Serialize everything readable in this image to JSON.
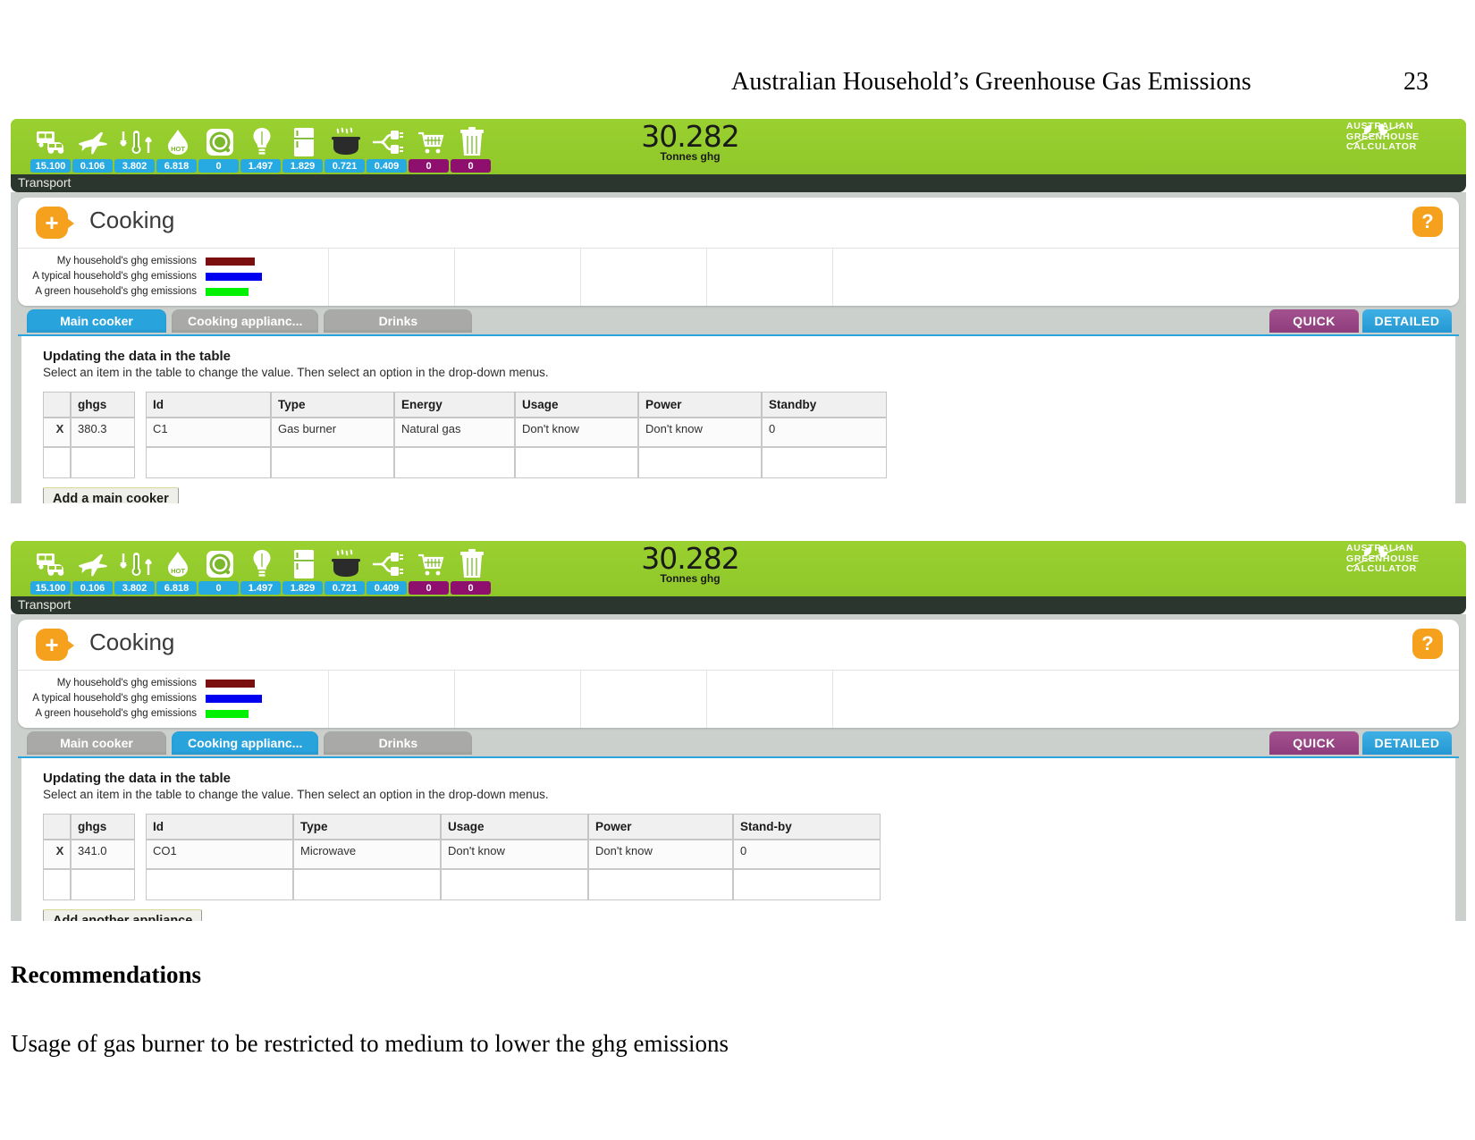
{
  "document": {
    "header_title": "Australian Household’s Greenhouse Gas Emissions",
    "page_number": "23",
    "recommendations_heading": "Recommendations",
    "recommendation_text": "Usage of gas burner to be restricted to medium to lower the ghg emissions"
  },
  "app": {
    "toolbar": {
      "total_value": "30.282",
      "total_unit": "Tonnes ghg",
      "logo_line1": "AUSTRALIAN",
      "logo_line2": "GREENHOUSE",
      "logo_line3": "CALCULATOR",
      "breadcrumb": "Transport",
      "icons": [
        {
          "name": "transport-icon",
          "value": "15.100",
          "color": "blue"
        },
        {
          "name": "flights-icon",
          "value": "0.106",
          "color": "blue"
        },
        {
          "name": "heating-cooling-icon",
          "value": "3.802",
          "color": "blue"
        },
        {
          "name": "hot-water-icon",
          "value": "6.818",
          "color": "blue"
        },
        {
          "name": "washing-icon",
          "value": "0",
          "color": "blue"
        },
        {
          "name": "lighting-icon",
          "value": "1.497",
          "color": "blue"
        },
        {
          "name": "fridge-icon",
          "value": "1.829",
          "color": "blue"
        },
        {
          "name": "cooking-icon",
          "value": "0.721",
          "color": "blue"
        },
        {
          "name": "appliances-icon",
          "value": "0.409",
          "color": "blue"
        },
        {
          "name": "shopping-icon",
          "value": "0",
          "color": "purple"
        },
        {
          "name": "waste-icon",
          "value": "0",
          "color": "purple"
        }
      ]
    },
    "card": {
      "title": "Cooking",
      "add_button_label": "+",
      "help_button_label": "?",
      "legend": [
        {
          "label": "My household's ghg emissions",
          "color": "#7b0f0f"
        },
        {
          "label": "A typical household's ghg emissions",
          "color": "#0000f0"
        },
        {
          "label": "A green household's ghg emissions",
          "color": "#00f100"
        }
      ]
    },
    "tabs": [
      {
        "label": "Main cooker"
      },
      {
        "label": "Cooking applianc..."
      },
      {
        "label": "Drinks"
      }
    ],
    "mode_buttons": {
      "quick": "QUICK",
      "detailed": "DETAILED"
    },
    "instructions": {
      "title": "Updating the data in the table",
      "subtitle": "Select an item in the table to change the value. Then select an option in the drop-down menus."
    }
  },
  "panel_one": {
    "active_tab_index": 0,
    "table": {
      "headers": [
        "",
        "ghgs",
        "Id",
        "Type",
        "Energy",
        "Usage",
        "Power",
        "Standby"
      ],
      "rows": [
        {
          "delete": "X",
          "ghgs": "380.3",
          "id": "C1",
          "type": "Gas burner",
          "energy": "Natural gas",
          "usage": "Don't know",
          "power": "Don't know",
          "standby": "0"
        }
      ]
    },
    "add_button": "Add a main cooker"
  },
  "panel_two": {
    "active_tab_index": 1,
    "table": {
      "headers": [
        "",
        "ghgs",
        "Id",
        "Type",
        "Usage",
        "Power",
        "Stand-by"
      ],
      "rows": [
        {
          "delete": "X",
          "ghgs": "341.0",
          "id": "CO1",
          "type": "Microwave",
          "usage": "Don't know",
          "power": "Don't know",
          "standby": "0"
        }
      ]
    },
    "add_button": "Add another appliance"
  }
}
